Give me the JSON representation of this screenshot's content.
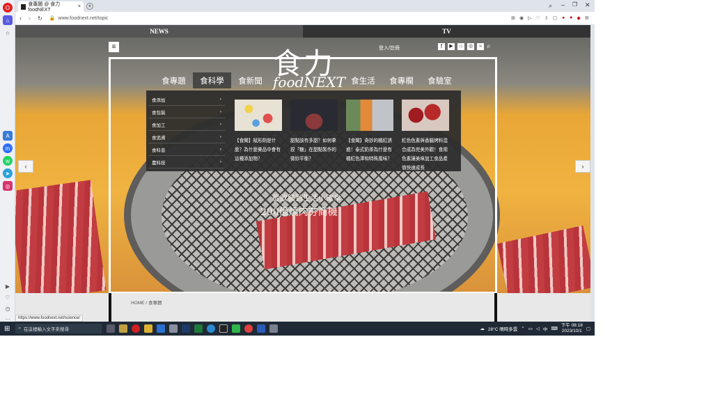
{
  "browser": {
    "tab_title": "食專題 @ 食力foodNEXT",
    "url": "www.foodnext.net/topic",
    "status_url": "https://www.foodnext.net/science/"
  },
  "site": {
    "top_tabs": [
      "NEWS",
      "TV"
    ],
    "login": "登入/註冊",
    "logo_cn": "食力",
    "logo_en": "foodNEXT",
    "menu": [
      "食專題",
      "食科學",
      "食新聞",
      "食生活",
      "食專欄",
      "食驗室"
    ],
    "dropdown_categories": [
      "食添加",
      "食包裝",
      "食加工",
      "食追溯",
      "食科普",
      "農科技"
    ],
    "cards": [
      {
        "title": "【食聞】賦形劑是什麼？為什麼藥品中會有這種添加物？"
      },
      {
        "title": "甜點該有多甜？如何拿捏「糖」在甜點製作的微妙平衡？"
      },
      {
        "title": "【食聞】奇妙的橘紅誘惑！泰式奶茶為什麼有橘紅色澤和特殊風味？"
      },
      {
        "title": "紅色色素與香腸烤料混合成為完美外觀！食用色素讓美味加工食品產值快速成長"
      }
    ],
    "hero_sub1": "從飲膳到生活小確幸",
    "hero_sub2": "200億燒肉夯商機",
    "breadcrumb_home": "HOME",
    "breadcrumb_current": "食專題"
  },
  "taskbar": {
    "search": "在這裡輸入文字來搜尋",
    "weather": "28°C 晴時多雲",
    "ime": "中",
    "time": "下午 08:18",
    "date": "2023/10/1"
  },
  "colors": {
    "accent": "#e4a23a",
    "nav_bg": "#3a3a3a"
  }
}
